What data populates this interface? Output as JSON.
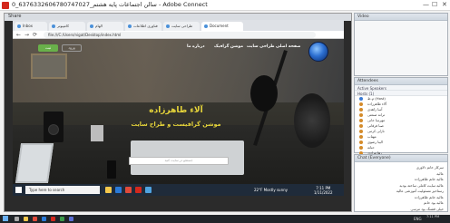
{
  "window": {
    "title": "0_6376332606780747027_سالن اجتماعات پایه هشتم - Adobe Connect",
    "min": "—",
    "max": "☐",
    "close": "✕"
  },
  "share_pod": {
    "title": "Share"
  },
  "browser": {
    "tabs": [
      "Inbox",
      "کامپیوتر",
      "الهام",
      "فناوری اطلاعات",
      "طراحی سایت",
      "Document"
    ],
    "url": "file:///C:/Users/nigat/Desktop/index.html",
    "back": "←",
    "forward": "→",
    "reload": "⟳"
  },
  "site": {
    "nav": [
      "صفحه اصلی",
      "طراحی سایت",
      "موشن گرافیک",
      "درباره ما"
    ],
    "btn_green": "ثبت",
    "btn_box": "ورود",
    "hero_name": "آلاء طاهرزاده",
    "hero_sub": "موشن گرافیست و طراح سایت",
    "search_placeholder": "جستجو در سایت کنید"
  },
  "remote_taskbar": {
    "search": "Type here to search",
    "weather": "22°F  Mostly sunny",
    "time": "7:11 PM",
    "date": "1/11/2022"
  },
  "video_pod": {
    "title": "Video"
  },
  "attendees_pod": {
    "title": "Attendees",
    "subtitle": "Active Speakers",
    "group": "Hosts (1)",
    "people": [
      "(Host) م.ط",
      "آلاء طاهرزاده",
      "آسا زاهدی",
      "ترانه صنعتی",
      "مهرسا خانی",
      "صبا فرقانی",
      "نازلی کرمی",
      "مهتاب",
      "الینا رضوی",
      "حنانه",
      "رها مرادی",
      "پرنیا"
    ]
  },
  "chat_pod": {
    "title": "Chat   (Everyone)",
    "lines": [
      "سرکار خانم دلاوری",
      "عالیه",
      "عالیه خانم طاهرزاده",
      "عالیه سایت کاملی ساخته بودید",
      "رستاخیز مسئولیت آموزشی عالیه",
      "عالیه خانم طاهرزاده",
      "عالیه بود خانم",
      "خیلی قشنگ بود مرسی",
      "عالیه"
    ]
  },
  "host_taskbar": {
    "lang": "ENG",
    "time": "7:11 PM",
    "date": "1/11/2022"
  }
}
